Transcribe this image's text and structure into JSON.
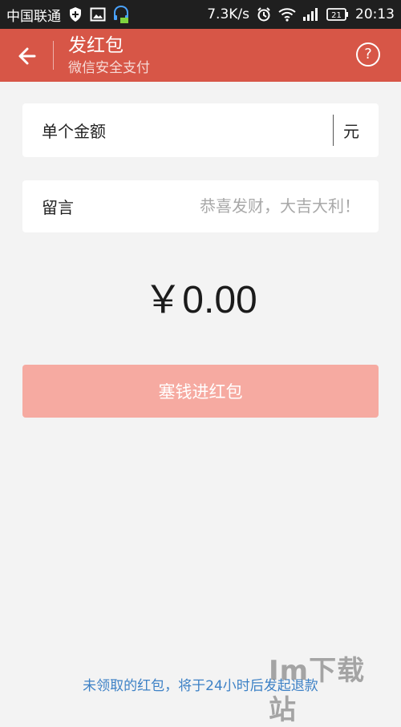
{
  "status_bar": {
    "carrier": "中国联通",
    "speed": "7.3K/s",
    "battery": "21",
    "time": "20:13"
  },
  "header": {
    "title": "发红包",
    "subtitle": "微信安全支付",
    "back_icon": "arrow-left-icon",
    "help_icon": "help-circle-icon"
  },
  "amount_field": {
    "label": "单个金额",
    "value": "",
    "unit": "元"
  },
  "message_field": {
    "label": "留言",
    "placeholder": "恭喜发财，大吉大利！",
    "value": ""
  },
  "amount_display": "￥0.00",
  "submit_button": "塞钱进红包",
  "footer_note": "未领取的红包，将于24小时后发起退款",
  "watermark": "Im下载站",
  "colors": {
    "status_bar_bg": "#1f1f1f",
    "header_bg": "#d75647",
    "page_bg": "#f3f3f3",
    "card_bg": "#ffffff",
    "submit_bg": "#f6aaa1",
    "footer_text": "#3d81c6"
  }
}
